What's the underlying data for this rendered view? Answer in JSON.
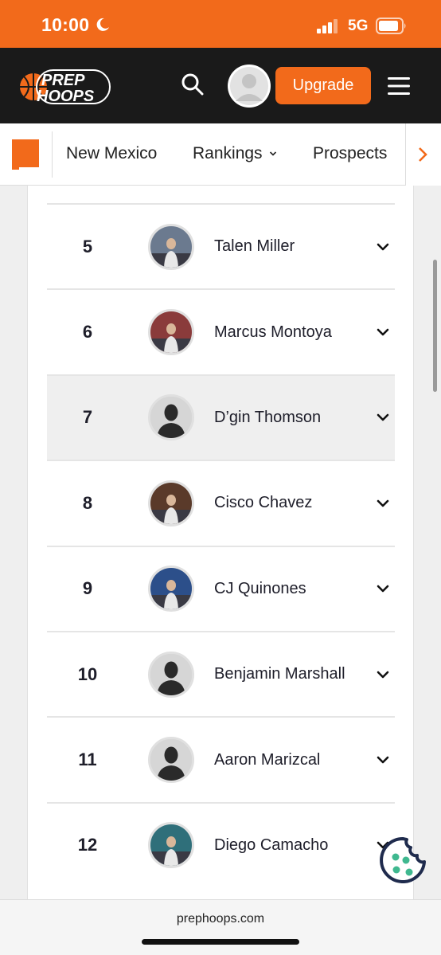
{
  "status_bar": {
    "time": "10:00",
    "network": "5G"
  },
  "header": {
    "logo_line1": "PREP",
    "logo_line2": "HOOPS",
    "upgrade_label": "Upgrade"
  },
  "subnav": {
    "state": "New Mexico",
    "items": [
      {
        "label": "Rankings"
      },
      {
        "label": "Prospects"
      }
    ]
  },
  "rankings": [
    {
      "rank": "5",
      "name": "Talen Miller",
      "photo": "photo"
    },
    {
      "rank": "6",
      "name": "Marcus Montoya",
      "photo": "photo"
    },
    {
      "rank": "7",
      "name": "D’gin Thomson",
      "photo": "placeholder"
    },
    {
      "rank": "8",
      "name": "Cisco Chavez",
      "photo": "photo"
    },
    {
      "rank": "9",
      "name": "CJ Quinones",
      "photo": "photo"
    },
    {
      "rank": "10",
      "name": "Benjamin Marshall",
      "photo": "placeholder"
    },
    {
      "rank": "11",
      "name": "Aaron Marizcal",
      "photo": "placeholder"
    },
    {
      "rank": "12",
      "name": "Diego Camacho",
      "photo": "photo"
    }
  ],
  "browser": {
    "url": "prephoops.com"
  },
  "colors": {
    "brand": "#f26a1b",
    "header_bg": "#1a1a1a",
    "text": "#1e1e2a"
  }
}
